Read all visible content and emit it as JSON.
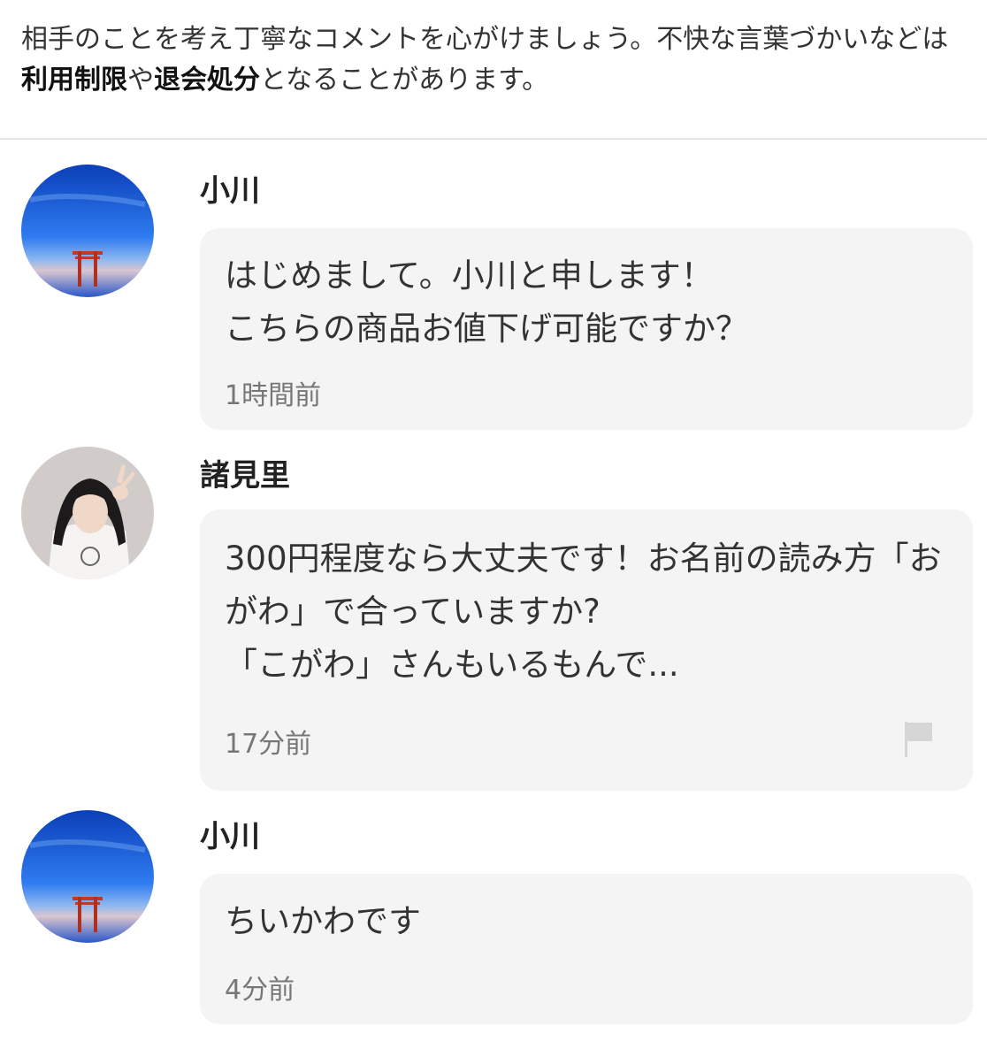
{
  "notice": {
    "part1": "相手のことを考え丁寧なコメントを心がけましょう。不快な言葉づかいなどは",
    "bold1": "利用制限",
    "part2": "や",
    "bold2": "退会処分",
    "part3": "となることがあります。"
  },
  "comments": [
    {
      "user": "小川",
      "avatar_icon": "sky-torii-avatar-icon",
      "text": "はじめまして。小川と申します！\nこちらの商品お値下げ可能ですか？",
      "time": "1時間前"
    },
    {
      "user": "諸見里",
      "avatar_icon": "person-photo-avatar-icon",
      "text": "300円程度なら大丈夫です！お名前の読み方「おがわ」で合っていますか?\n「こがわ」さんもいるもんで...",
      "time": "17分前",
      "report_icon": "flag-icon"
    },
    {
      "user": "小川",
      "avatar_icon": "sky-torii-avatar-icon",
      "text": "ちいかわです",
      "time": "4分前"
    }
  ],
  "colors": {
    "bubble": "#f4f4f5",
    "time_text": "#777777",
    "divider": "#e6e6e6"
  }
}
